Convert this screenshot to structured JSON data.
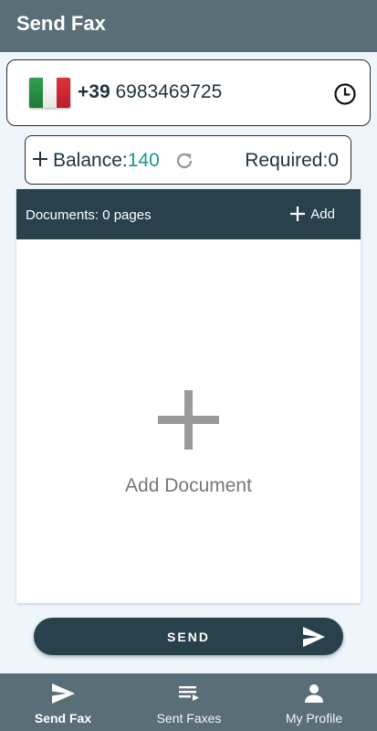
{
  "app_bar": {
    "title": "Send Fax"
  },
  "recipient": {
    "country_flag": "italy-flag",
    "country_code": "+39",
    "number": "6983469725",
    "history_icon": "history-icon"
  },
  "balance": {
    "label": "Balance:",
    "value": "140",
    "required_label": "Required:",
    "required_value": "0",
    "value_color": "#1a9a82"
  },
  "documents": {
    "count_text": "Documents: 0 pages",
    "add_label": "Add",
    "empty_label": "Add Document"
  },
  "send_button": {
    "label": "SEND"
  },
  "bottom_nav": {
    "items": [
      {
        "label": "Send Fax",
        "icon": "send-icon",
        "active": true
      },
      {
        "label": "Sent Faxes",
        "icon": "list-icon",
        "active": false
      },
      {
        "label": "My Profile",
        "icon": "person-icon",
        "active": false
      }
    ]
  },
  "colors": {
    "app_bar": "#5a6e78",
    "header_dark": "#29414d",
    "background": "#eef5fb"
  }
}
